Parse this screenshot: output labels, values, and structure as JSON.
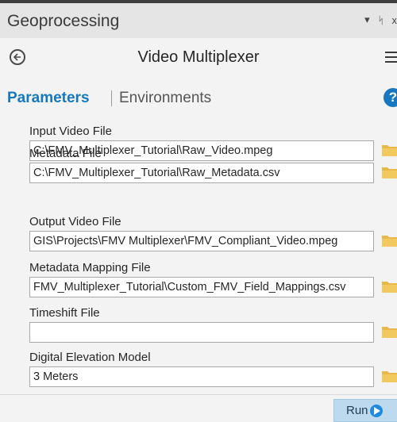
{
  "window": {
    "title": "Geoprocessing",
    "controls": {
      "pin": "▾",
      "autohide": "ᛋ",
      "close": "x"
    }
  },
  "tool": {
    "title": "Video Multiplexer",
    "back_icon": "back-arrow-icon",
    "menu_icon": "hamburger-menu-icon"
  },
  "tabs": {
    "parameters": "Parameters",
    "environments": "Environments",
    "help": "?"
  },
  "params": [
    {
      "label": "Input Video File",
      "value": "C:\\FMV_Multiplexer_Tutorial\\Raw_Video.mpeg"
    },
    {
      "label": "Metadata File",
      "value": "C:\\FMV_Multiplexer_Tutorial\\Raw_Metadata.csv"
    },
    {
      "label": "Output Video File",
      "value": "GIS\\Projects\\FMV Multiplexer\\FMV_Compliant_Video.mpeg"
    },
    {
      "label": "Metadata Mapping File",
      "value": "FMV_Multiplexer_Tutorial\\Custom_FMV_Field_Mappings.csv"
    },
    {
      "label": "Timeshift File",
      "value": ""
    },
    {
      "label": "Digital Elevation Model",
      "value": "3 Meters"
    }
  ],
  "footer": {
    "run_label": "Run"
  },
  "colors": {
    "accent": "#1778bf",
    "folder": "#e8b84a",
    "run_bg": "#bcd9ee"
  }
}
